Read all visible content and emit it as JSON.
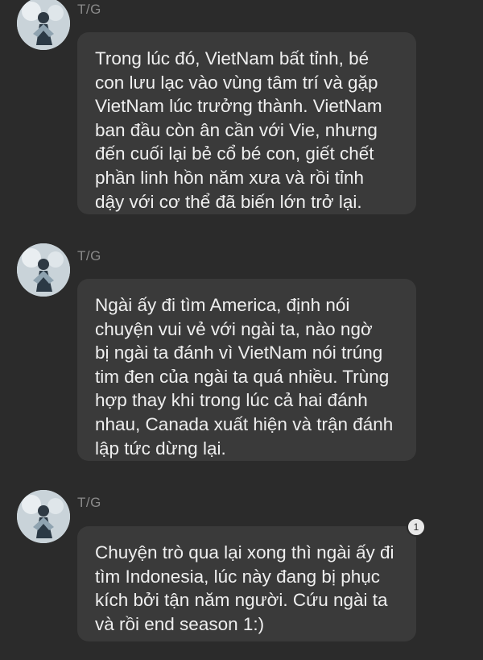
{
  "messages": [
    {
      "sender": "T/G",
      "text": "Trong lúc đó, VietNam bất tỉnh, bé\ncon lưu lạc vào vùng tâm trí và gặp\nVietNam lúc trưởng thành. VietNam\nban đầu còn ân cần với Vie, nhưng\nđến cuối lại bẻ cổ bé con, giết chết\nphần linh hồn năm xưa và rồi tỉnh\ndậy với cơ thể đã biến lớn trở lại."
    },
    {
      "sender": "T/G",
      "text": "Ngài ấy đi tìm America, định nói\nchuyện vui vẻ với ngài ta, nào ngờ\nbị ngài ta đánh vì VietNam nói trúng\ntim đen của ngài ta quá nhiều. Trùng\nhợp thay khi trong lúc cả hai đánh\nnhau, Canada xuất hiện và trận đánh\nlập tức dừng lại."
    },
    {
      "sender": "T/G",
      "text": "Chuyện trò qua lại xong thì ngài ấy đi\ntìm Indonesia, lúc này đang bị phục\nkích bởi tận năm người. Cứu ngài ta\nvà rồi end season 1:)",
      "reaction_count": "1"
    }
  ],
  "colors": {
    "background": "#2b2b2b",
    "bubble": "#3a3a3a",
    "text": "#efefef",
    "sender": "#8a8a8a"
  },
  "icons": {
    "avatar": "profile-avatar-icon"
  }
}
